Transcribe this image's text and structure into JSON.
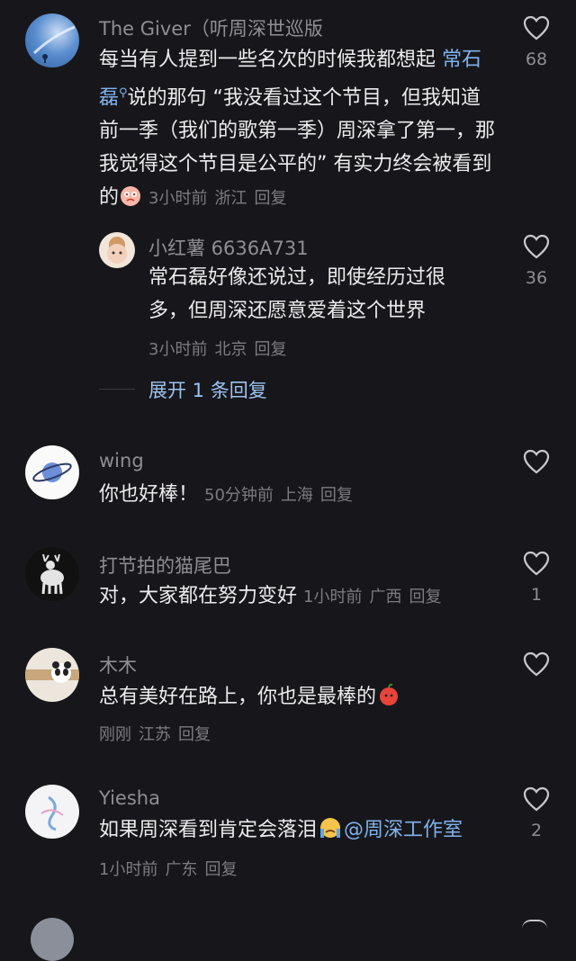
{
  "comments": [
    {
      "author": "The Giver（听周深世巡版",
      "text_parts": [
        "每当有人提到一些名次的时候我都想起 ",
        "常石磊",
        "说的那句 “我没看过这个节目，但我知道前一季（我们的歌第一季）周深拿了第一，那我觉得这个节目是公平的” 有实力终会被看到的"
      ],
      "time": "3小时前",
      "location": "浙江",
      "reply_label": "回复",
      "likes": "68",
      "emoji": "crying-face-emoji"
    },
    {
      "author": "小红薯 6636A731",
      "text": "常石磊好像还说过，即使经历过很多，但周深还愿意爱着这个世界",
      "time": "3小时前",
      "location": "北京",
      "reply_label": "回复",
      "likes": "36"
    },
    {
      "author": "wing",
      "text": "你也好棒！",
      "time": "50分钟前",
      "location": "上海",
      "reply_label": "回复",
      "likes": ""
    },
    {
      "author": "打节拍的猫尾巴",
      "text": "对，大家都在努力变好",
      "time": "1小时前",
      "location": "广西",
      "reply_label": "回复",
      "likes": "1"
    },
    {
      "author": "木木",
      "text": "总有美好在路上，你也是最棒的",
      "time": "刚刚",
      "location": "江苏",
      "reply_label": "回复",
      "likes": "",
      "emoji": "apple-face-emoji"
    },
    {
      "author": "Yiesha",
      "text": "如果周深看到肯定会落泪",
      "mention": "@周深工作室",
      "time": "1小时前",
      "location": "广东",
      "reply_label": "回复",
      "likes": "2",
      "emoji": "crying-emoji"
    }
  ],
  "expand_replies": "展开 1 条回复",
  "colors": {
    "background": "#17171b",
    "mention": "#7fb2ee",
    "meta": "#7c7c80"
  },
  "icons": [
    "heart-icon",
    "search-icon"
  ]
}
